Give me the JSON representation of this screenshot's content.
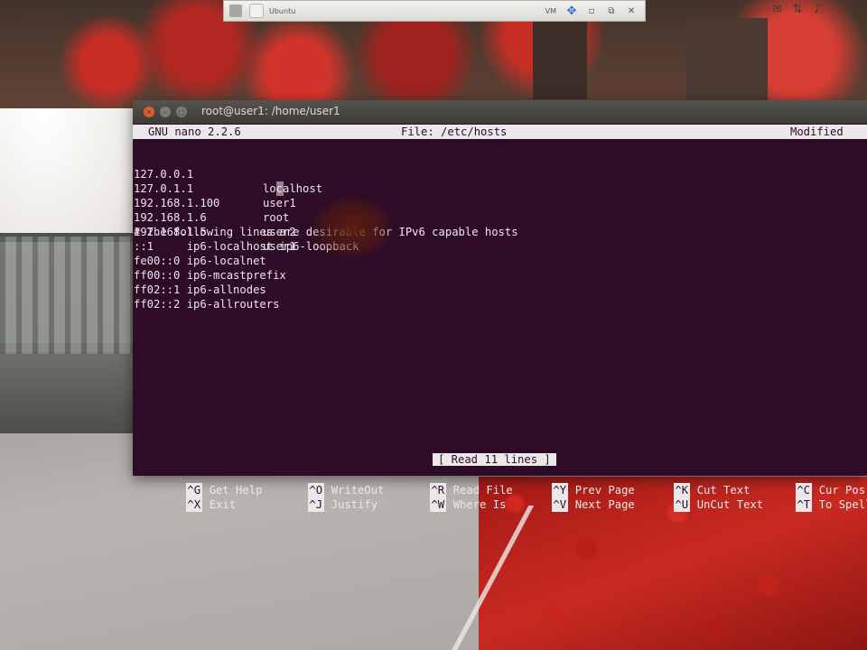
{
  "taskbar": {
    "vm_title": "Ubuntu",
    "vm_menu": "VM",
    "icons": [
      "home-icon",
      "ubuntu-icon",
      "send-keys-icon",
      "fullscreen-icon",
      "restore-icon",
      "close-icon"
    ]
  },
  "system_tray": {
    "icons": [
      "mail-icon",
      "network-icon",
      "volume-icon"
    ]
  },
  "window": {
    "title": "root@user1: /home/user1"
  },
  "nano": {
    "version": "GNU nano 2.2.6",
    "file": "File: /etc/hosts",
    "state": "Modified",
    "lines": [
      {
        "ip": "127.0.0.1",
        "host": "localhost"
      },
      {
        "ip": "127.0.1.1",
        "host": "user1"
      },
      {
        "ip": "192.168.1.100",
        "host": "root"
      },
      {
        "ip": "192.168.1.6",
        "host": "user2"
      },
      {
        "ip": "192.168.1.5",
        "host": "user1"
      },
      {
        "text": "# The following lines are desirable for IPv6 capable hosts"
      },
      {
        "text": "::1     ip6-localhost ip6-loopback"
      },
      {
        "text": "fe00::0 ip6-localnet"
      },
      {
        "text": "ff00::0 ip6-mcastprefix"
      },
      {
        "text": "ff02::1 ip6-allnodes"
      },
      {
        "text": "ff02::2 ip6-allrouters"
      }
    ],
    "status_message": "[ Read 11 lines ]",
    "shortcuts": [
      {
        "key": "^G",
        "label": "Get Help"
      },
      {
        "key": "^O",
        "label": "WriteOut"
      },
      {
        "key": "^R",
        "label": "Read File"
      },
      {
        "key": "^Y",
        "label": "Prev Page"
      },
      {
        "key": "^K",
        "label": "Cut Text"
      },
      {
        "key": "^C",
        "label": "Cur Pos"
      },
      {
        "key": "^X",
        "label": "Exit"
      },
      {
        "key": "^J",
        "label": "Justify"
      },
      {
        "key": "^W",
        "label": "Where Is"
      },
      {
        "key": "^V",
        "label": "Next Page"
      },
      {
        "key": "^U",
        "label": "UnCut Text"
      },
      {
        "key": "^T",
        "label": "To Spell"
      }
    ]
  }
}
